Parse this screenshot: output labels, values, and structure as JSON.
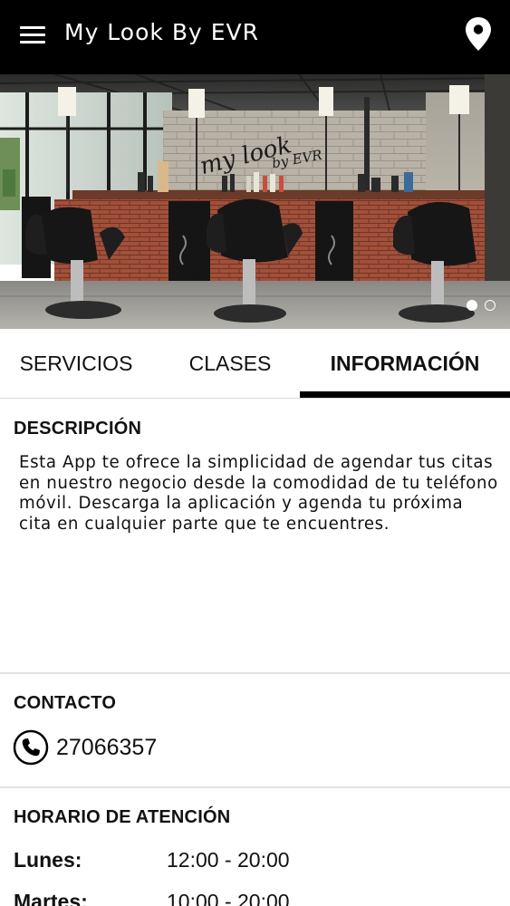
{
  "app": {
    "title": "My Look By EVR"
  },
  "hero": {
    "slide_count": 2,
    "active_slide": 1,
    "signage_text": "my look by EVR"
  },
  "tabs": [
    {
      "label": "SERVICIOS",
      "selected": false
    },
    {
      "label": "CLASES",
      "selected": false
    },
    {
      "label": "INFORMACIÓN",
      "selected": true
    }
  ],
  "description": {
    "title": "DESCRIPCIÓN",
    "text": "Esta App te ofrece la simplicidad de agendar tus citas en nuestro negocio desde la comodidad de tu teléfono móvil. Descarga la aplicación y agenda tu próxima cita en cualquier parte que te encuentres."
  },
  "contact": {
    "title": "CONTACTO",
    "phone": "27066357",
    "icon": "phone-icon"
  },
  "hours": {
    "title": "HORARIO DE ATENCIÓN",
    "rows": [
      {
        "day": "Lunes:",
        "time": "12:00 - 20:00"
      },
      {
        "day": "Martes:",
        "time": "10:00 - 20:00"
      }
    ]
  },
  "icons": {
    "menu": "hamburger-menu-icon",
    "location": "map-pin-icon"
  },
  "colors": {
    "appbar": "#000000",
    "tab_indicator": "#000000",
    "divider": "#e2e2e2",
    "text": "#111111"
  }
}
